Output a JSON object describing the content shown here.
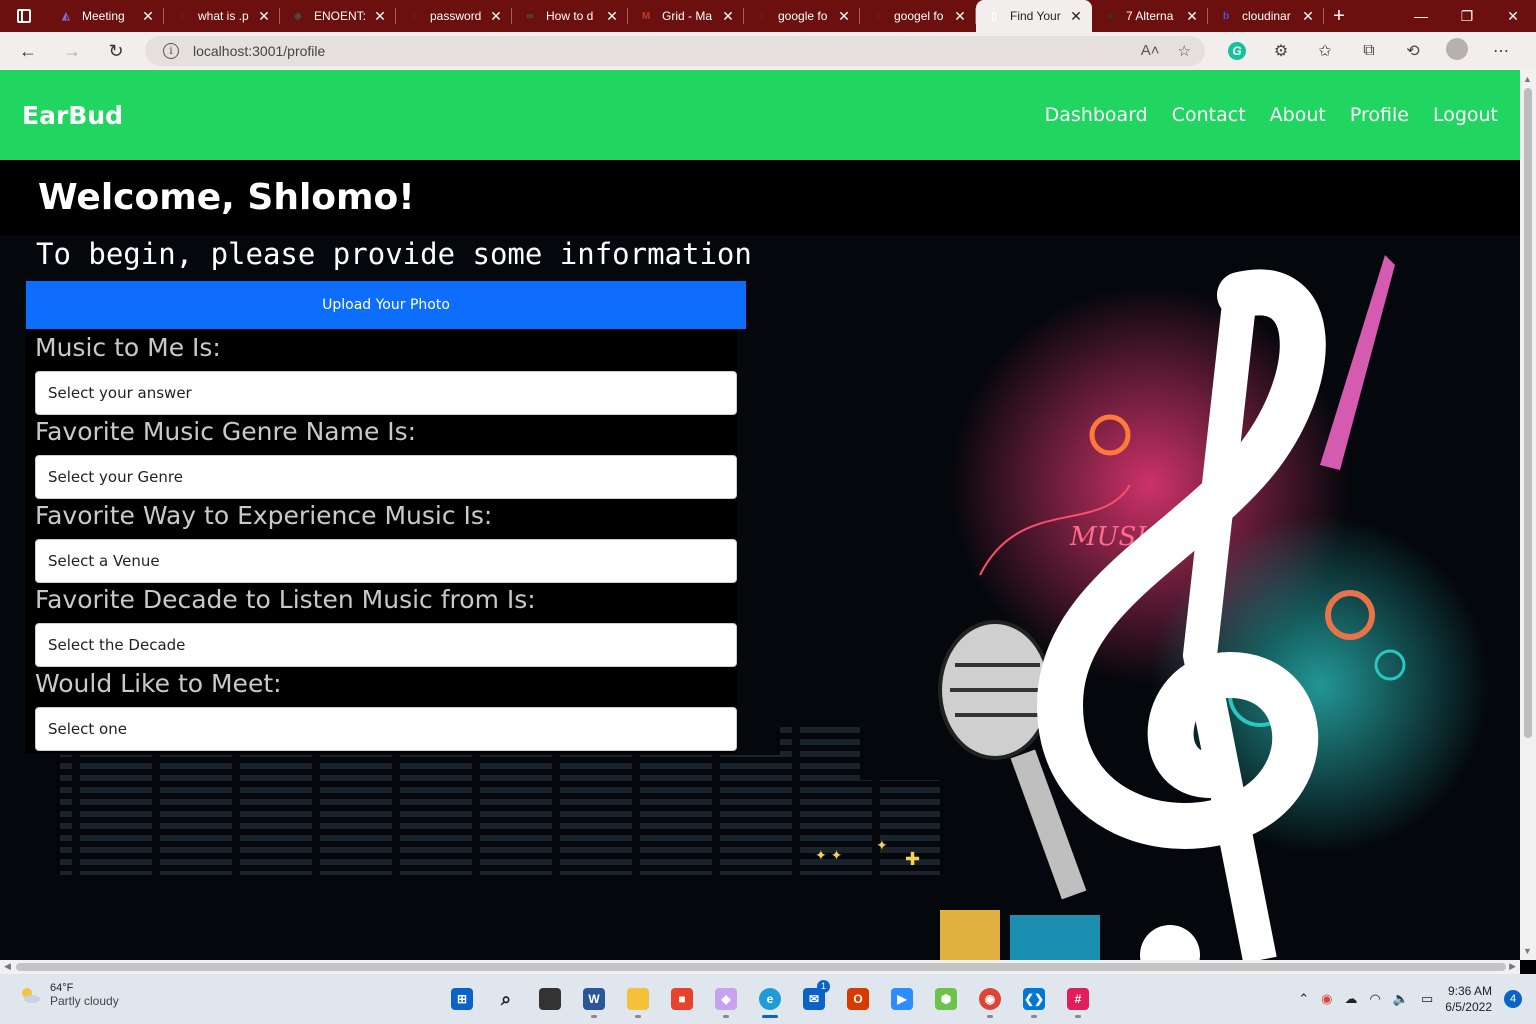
{
  "browser": {
    "tabs": [
      {
        "title": "Meeting",
        "fav_color": "#8a6bd1",
        "fav": "◭"
      },
      {
        "title": "what is .p",
        "fav_color": "#5a3a3a",
        "fav": "○"
      },
      {
        "title": "ENOENT:",
        "fav_color": "#4a4a4a",
        "fav": "◈"
      },
      {
        "title": "password",
        "fav_color": "#5a3a3a",
        "fav": "○"
      },
      {
        "title": "How to d",
        "fav_color": "#2f6e3a",
        "fav": "∞"
      },
      {
        "title": "Grid - Ma",
        "fav_color": "#c0392b",
        "fav": "M"
      },
      {
        "title": "google fo",
        "fav_color": "#5a3a3a",
        "fav": "○"
      },
      {
        "title": "googel fo",
        "fav_color": "#5a3a3a",
        "fav": "○"
      },
      {
        "title": "Find Your",
        "fav_color": "#ffffff",
        "fav": "▯"
      },
      {
        "title": "7 Alterna",
        "fav_color": "#333333",
        "fav": "●"
      },
      {
        "title": "cloudinar",
        "fav_color": "#3b5bdb",
        "fav": "b"
      }
    ],
    "active_tab_index": 8,
    "url": "localhost:3001/profile"
  },
  "app": {
    "brand": "EarBud",
    "nav": [
      "Dashboard",
      "Contact",
      "About",
      "Profile",
      "Logout"
    ],
    "welcome": "Welcome, Shlomo!",
    "intro": "To begin, please provide some information",
    "upload_label": "Upload Your Photo",
    "questions": [
      {
        "label": "Music to Me Is:",
        "placeholder": "Select your answer"
      },
      {
        "label": "Favorite Music Genre Name Is:",
        "placeholder": "Select your Genre"
      },
      {
        "label": "Favorite Way to Experience Music Is:",
        "placeholder": "Select a Venue"
      },
      {
        "label": "Favorite Decade to Listen Music from Is:",
        "placeholder": "Select the Decade"
      },
      {
        "label": "Would Like to Meet:",
        "placeholder": "Select one"
      }
    ],
    "hero_graffiti": "MUSIC"
  },
  "colors": {
    "navbar": "#20d661",
    "upload_button": "#0d6efd",
    "tabstrip": "#6b0f0f"
  },
  "taskbar": {
    "weather_temp": "64°F",
    "weather_desc": "Partly cloudy",
    "time": "9:36 AM",
    "date": "6/5/2022",
    "notifications": "4",
    "mail_badge": "1"
  }
}
